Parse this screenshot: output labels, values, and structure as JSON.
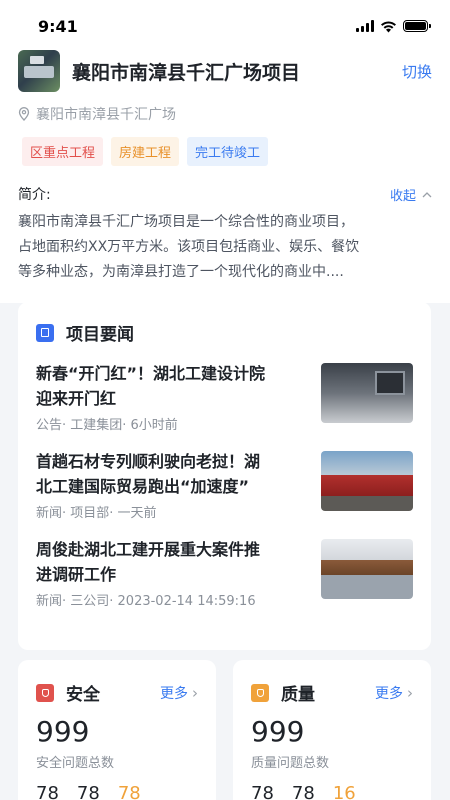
{
  "status_bar": {
    "time": "9:41"
  },
  "project": {
    "title": "襄阳市南漳县千汇广场项目",
    "switch_label": "切换",
    "address": "襄阳市南漳县千汇广场",
    "tags": [
      {
        "label": "区重点工程",
        "color": "#e2504c"
      },
      {
        "label": "房建工程",
        "color": "#e8912b"
      },
      {
        "label": "完工待竣工",
        "color": "#3a7bf0"
      }
    ],
    "intro_label": "简介:",
    "collapse_label": "收起",
    "intro_lines": [
      "襄阳市南漳县千汇广场项目是一个综合性的商业项目，",
      "占地面积约XX万平方米。该项目包括商业、娱乐、餐饮",
      "等多种业态，为南漳县打造了一个现代化的商业中...."
    ]
  },
  "news": {
    "title": "项目要闻",
    "items": [
      {
        "title_lines": [
          "新春“开门红”！湖北工建设计院",
          "迎来开门红"
        ],
        "meta": "公告·  工建集团·   6小时前"
      },
      {
        "title_lines": [
          "首趟石材专列顺利驶向老挝！湖",
          "北工建国际贸易跑出“加速度”"
        ],
        "meta": "新闻·  项目部·  一天前"
      },
      {
        "title_lines": [
          "周俊赴湖北工建开展重大案件推",
          "进调研工作"
        ],
        "meta": "新闻·  三公司·  2023-02-14 14:59:16"
      }
    ]
  },
  "safety": {
    "title": "安全",
    "more_label": "更多",
    "total": "999",
    "total_label": "安全问题总数",
    "nums": [
      "78",
      "78",
      "78"
    ]
  },
  "quality": {
    "title": "质量",
    "more_label": "更多",
    "total": "999",
    "total_label": "质量问题总数",
    "nums": [
      "78",
      "78",
      "16"
    ]
  },
  "colors": {
    "accent": "#3a7bf0",
    "warning": "#f0a23a",
    "danger": "#e0524d"
  }
}
